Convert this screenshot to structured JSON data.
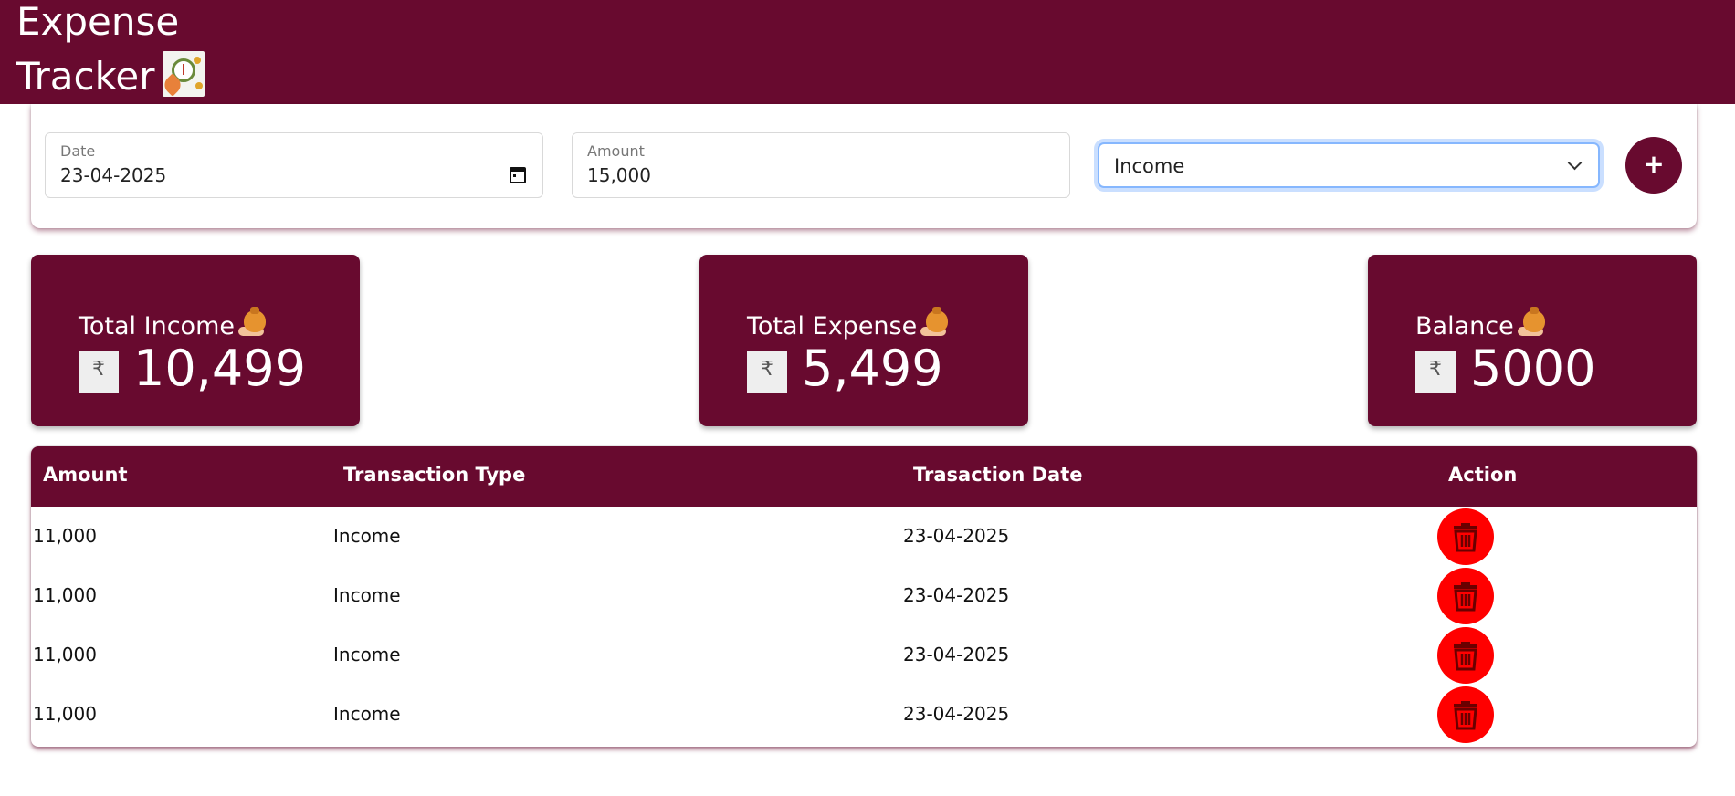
{
  "header": {
    "title_line1": "Expense",
    "title_line2": "Tracker",
    "logo_icon": "expense-logo-icon"
  },
  "form": {
    "date_label": "Date",
    "date_value": "23-04-2025",
    "amount_label": "Amount",
    "amount_value": "15,000",
    "type_selected": "Income",
    "add_label": "+"
  },
  "summary": {
    "income_label": "Total Income",
    "income_value": "10,499",
    "expense_label": "Total Expense",
    "expense_value": "5,499",
    "balance_label": "Balance",
    "balance_value": "5000",
    "currency_symbol": "₹"
  },
  "table": {
    "headers": {
      "amount": "Amount",
      "type": "Transaction Type",
      "date": "Trasaction Date",
      "action": "Action"
    },
    "rows": [
      {
        "amount": "11,000",
        "type": "Income",
        "date": "23-04-2025"
      },
      {
        "amount": "11,000",
        "type": "Income",
        "date": "23-04-2025"
      },
      {
        "amount": "11,000",
        "type": "Income",
        "date": "23-04-2025"
      },
      {
        "amount": "11,000",
        "type": "Income",
        "date": "23-04-2025"
      }
    ]
  },
  "colors": {
    "brand": "#680a2f",
    "delete": "#ff0000",
    "focus": "#86b7fe"
  }
}
